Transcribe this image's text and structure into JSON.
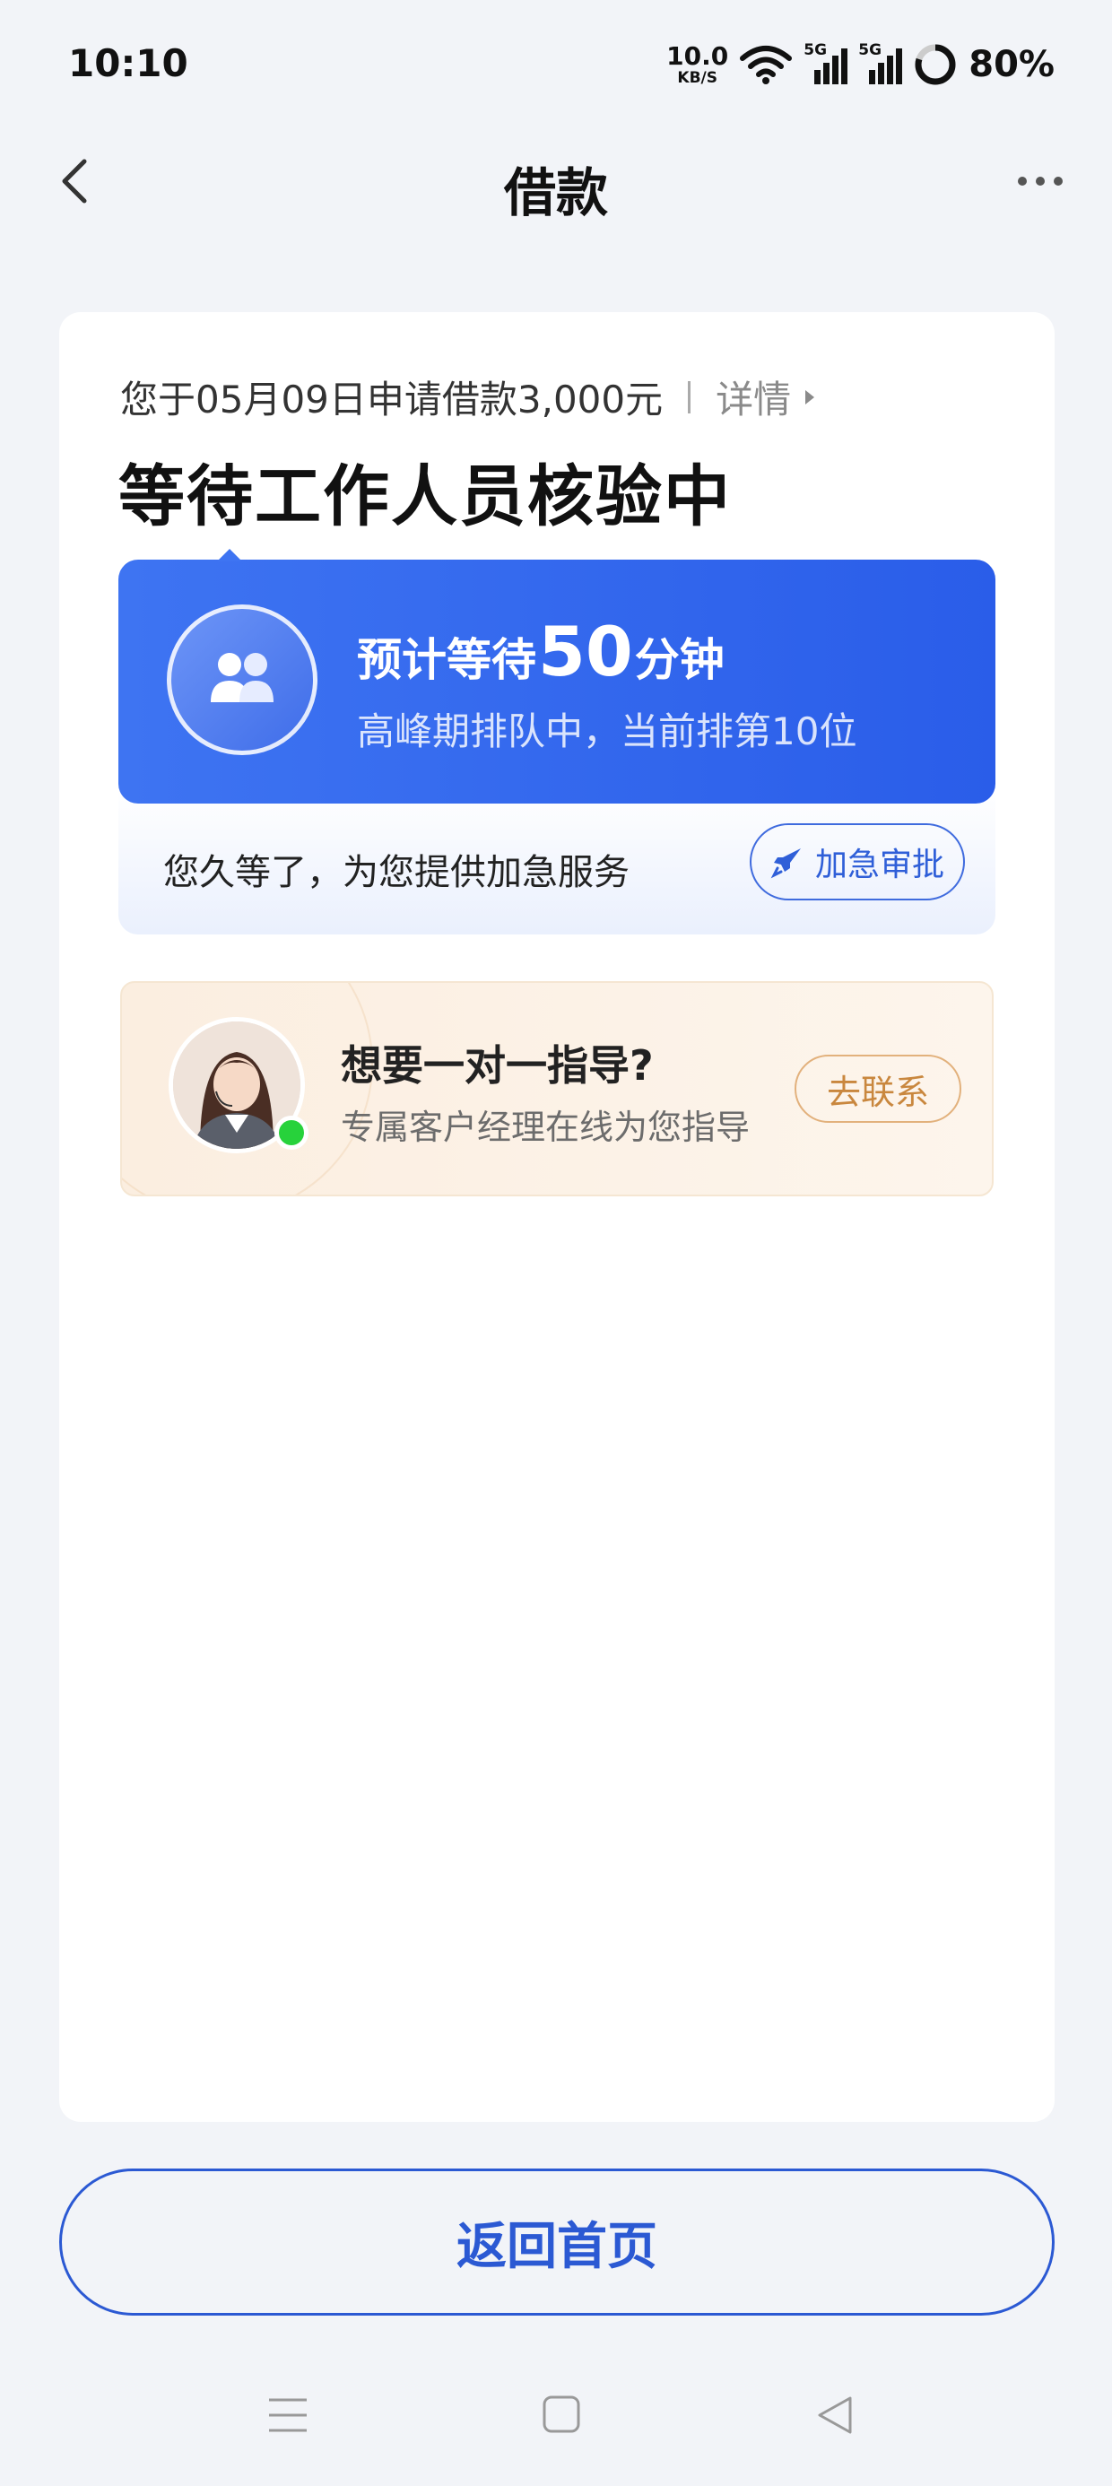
{
  "status_bar": {
    "time": "10:10",
    "net_speed_value": "10.0",
    "net_speed_unit": "KB/S",
    "signal1_label": "5G",
    "signal2_label": "5G",
    "battery_percent": "80%"
  },
  "nav": {
    "title": "借款"
  },
  "loan": {
    "apply_text": "您于05月09日申请借款3,000元",
    "detail_label": "详情",
    "status_title": "等待工作人员核验中"
  },
  "wait": {
    "prefix": "预计等待",
    "minutes": "50",
    "suffix": "分钟",
    "queue_text": "高峰期排队中，当前排第10位",
    "service_text": "您久等了，为您提供加急服务",
    "urgent_button": "加急审批"
  },
  "guide": {
    "title": "想要一对一指导?",
    "subtitle": "专属客户经理在线为您指导",
    "contact_button": "去联系"
  },
  "footer": {
    "home_button": "返回首页"
  },
  "colors": {
    "primary": "#2b59d3",
    "panel_blue": "#3e74f2",
    "online": "#27d23b",
    "contact": "#c9873e"
  }
}
